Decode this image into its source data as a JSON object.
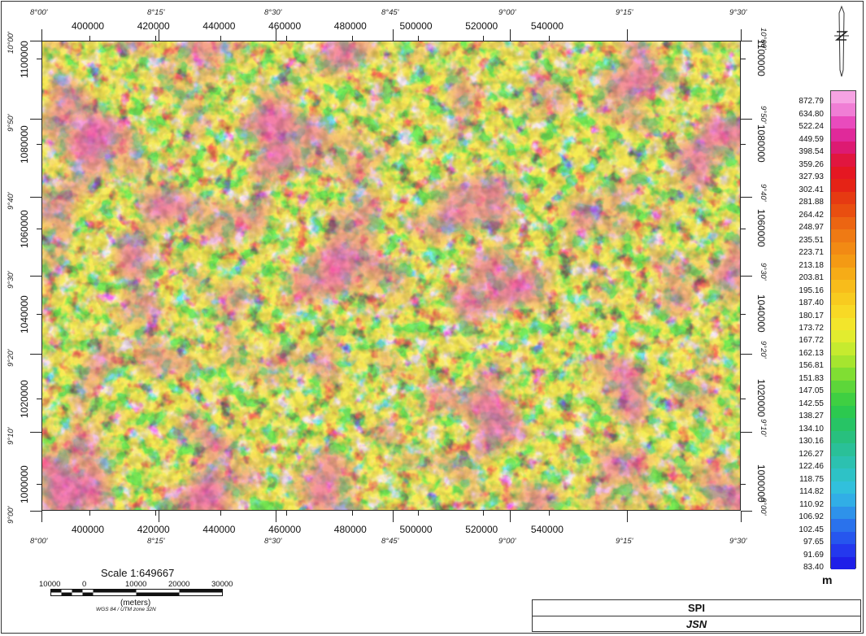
{
  "map": {
    "grid_x": [
      "400000",
      "420000",
      "440000",
      "460000",
      "480000",
      "500000",
      "520000",
      "540000"
    ],
    "grid_y": [
      "1100000",
      "1080000",
      "1060000",
      "1040000",
      "1020000",
      "1000000"
    ],
    "lon_labels": [
      "8°00'",
      "8°15'",
      "8°30'",
      "8°45'",
      "9°00'",
      "9°15'",
      "9°30'"
    ],
    "lat_labels": [
      "10°00'",
      "9°50'",
      "9°40'",
      "9°30'",
      "9°20'",
      "9°10'",
      "9°00'"
    ],
    "colors": {
      "frame": "#333333",
      "map_bg": "#3aa6c7"
    }
  },
  "legend": {
    "unit": "m",
    "values": [
      "872.79",
      "634.80",
      "522.24",
      "449.59",
      "398.54",
      "359.26",
      "327.93",
      "302.41",
      "281.88",
      "264.42",
      "248.97",
      "235.51",
      "223.71",
      "213.18",
      "203.81",
      "195.16",
      "187.40",
      "180.17",
      "173.72",
      "167.72",
      "162.13",
      "156.81",
      "151.83",
      "147.05",
      "142.55",
      "138.27",
      "134.10",
      "130.16",
      "126.27",
      "122.46",
      "118.75",
      "114.82",
      "110.92",
      "106.92",
      "102.45",
      "97.65",
      "91.69",
      "83.40"
    ],
    "colors": [
      "#f6a3e3",
      "#f07ed5",
      "#e94bbd",
      "#e0299a",
      "#dd1a72",
      "#e1163f",
      "#e51722",
      "#e52316",
      "#e63a12",
      "#e94e10",
      "#ec6512",
      "#ef7a14",
      "#f28a14",
      "#f49a14",
      "#f6ac17",
      "#f8bc1b",
      "#f8cb1f",
      "#f8d925",
      "#f3e52b",
      "#e2ec2f",
      "#c6eb2f",
      "#a6e52f",
      "#80de33",
      "#5dd63a",
      "#3fcf42",
      "#2cc94f",
      "#27c465",
      "#28c07e",
      "#2ac098",
      "#2cc1b0",
      "#2ec2c6",
      "#31c0dc",
      "#31aee6",
      "#2e92ea",
      "#2a72ec",
      "#2656ee",
      "#2438ee",
      "#1f1fe8"
    ]
  },
  "scale": {
    "title": "Scale 1:649667",
    "ticks": [
      "10000",
      "0",
      "10000",
      "20000",
      "30000"
    ],
    "unit": "(meters)",
    "projection": "WGS 84 / UTM zone 32N"
  },
  "title_block": {
    "line1": "SPI",
    "line2": "JSN"
  }
}
